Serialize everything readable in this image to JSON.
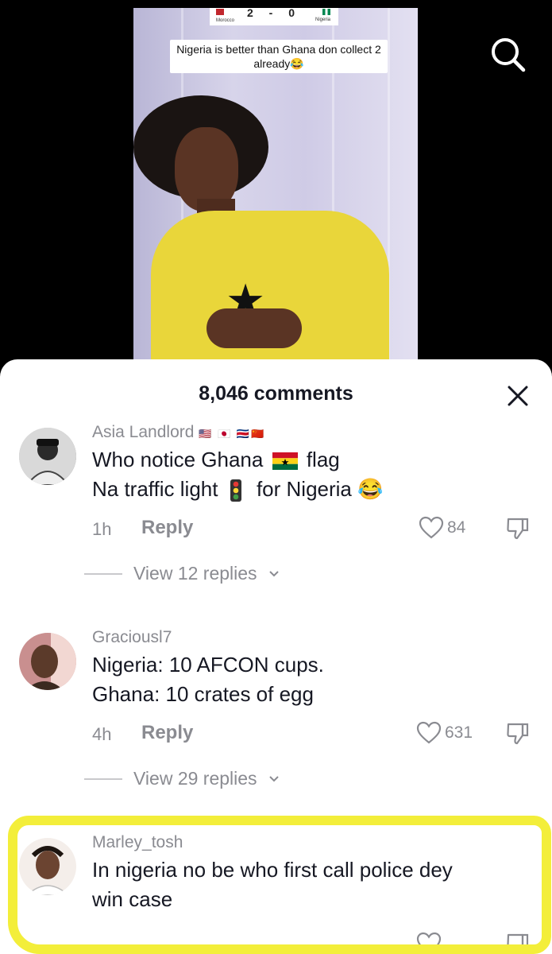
{
  "video": {
    "scoreboard": {
      "team_home": "Morocco",
      "team_away": "Nigeria",
      "score": "2 - 0"
    },
    "caption": "Nigeria is better than Ghana don collect 2 already😂"
  },
  "comments_sheet": {
    "title": "8,046 comments",
    "comments": [
      {
        "username": "Asia Landlord",
        "username_flags": "🇺🇸 🇯🇵 🇨🇷🇨🇳",
        "line1_a": "Who notice Ghana",
        "line1_b": "flag",
        "line2_a": "Na traffic light",
        "line2_b": "for Nigeria 😂",
        "time": "1h",
        "reply_label": "Reply",
        "likes": "84",
        "view_replies": "View 12 replies"
      },
      {
        "username": "Graciousl7",
        "line1": "Nigeria: 10 AFCON cups.",
        "line2": "Ghana: 10 crates of egg",
        "time": "4h",
        "reply_label": "Reply",
        "likes": "631",
        "view_replies": "View 29 replies"
      },
      {
        "username": "Marley_tosh",
        "line1": "In nigeria no be who first call police dey",
        "line2": "win case"
      }
    ]
  },
  "colors": {
    "highlight": "#f3ee3a",
    "jersey": "#e9d63a",
    "muted_text": "#8a8b91"
  }
}
